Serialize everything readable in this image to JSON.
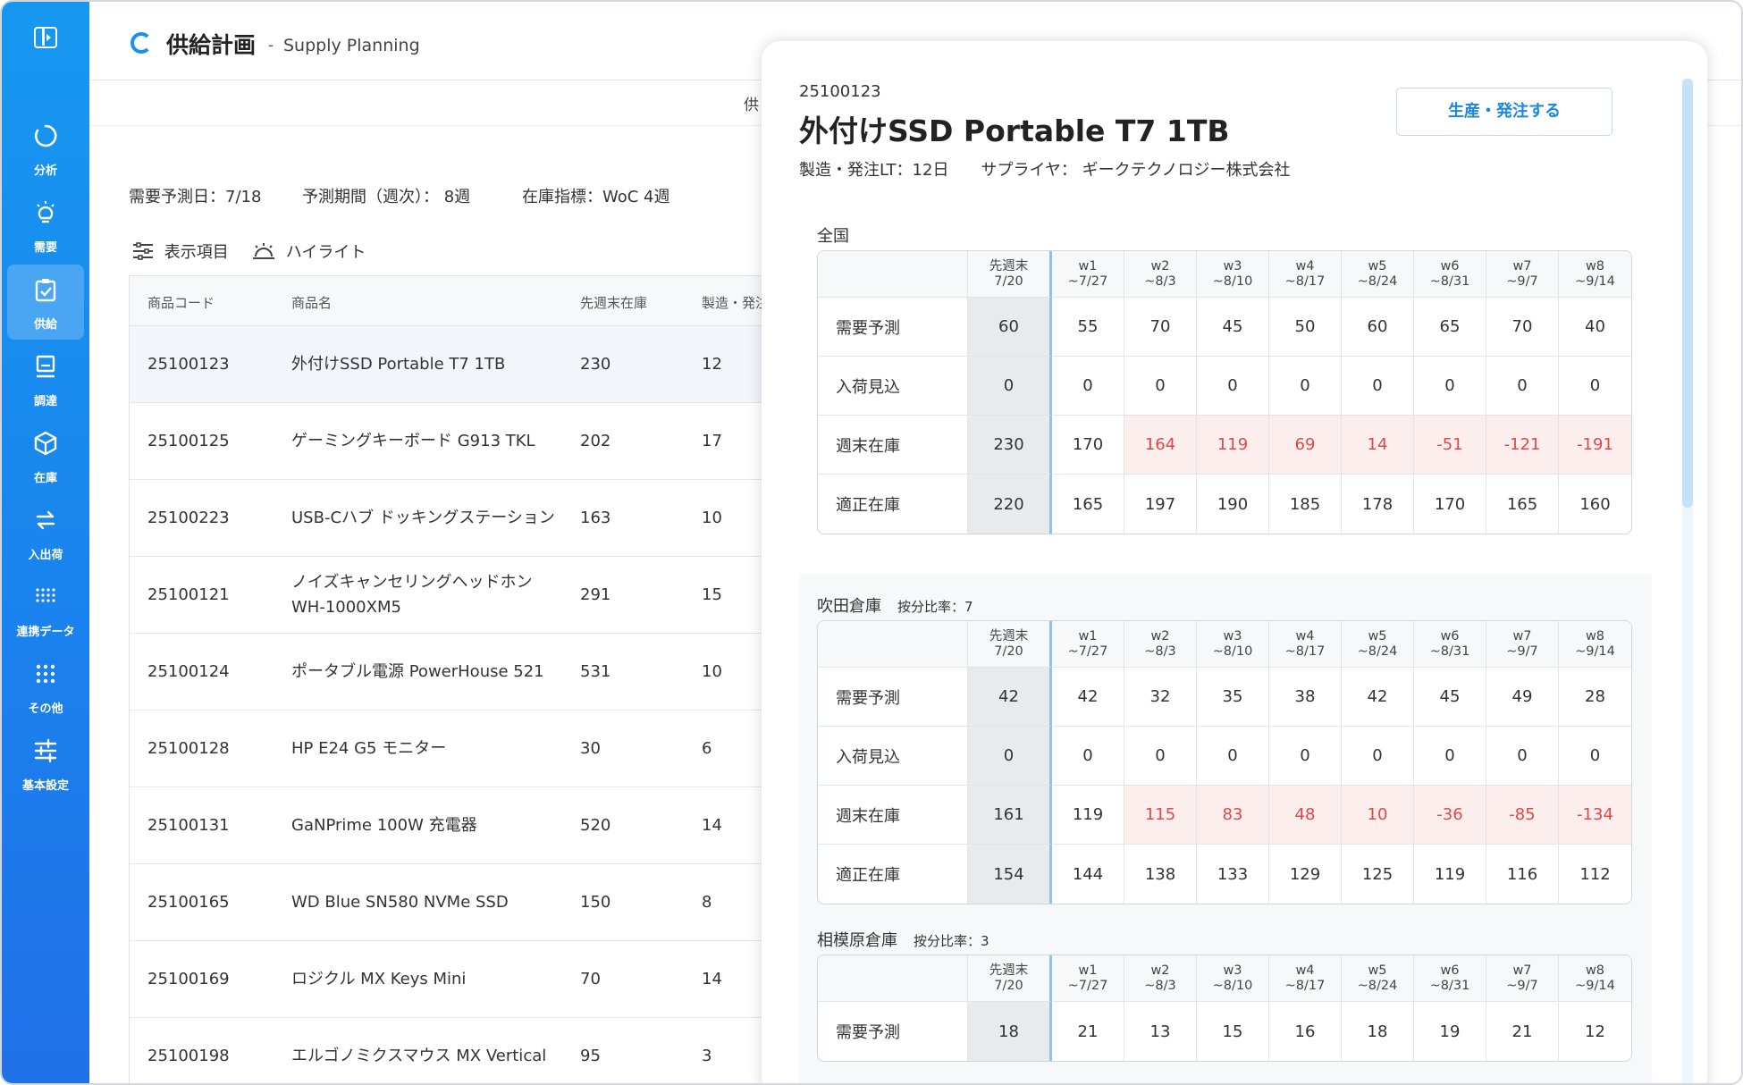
{
  "nav": [
    {
      "name": "analysis",
      "label": "分析",
      "icon": "loading-ring-icon"
    },
    {
      "name": "demand",
      "label": "需要",
      "icon": "light-bulb-icon"
    },
    {
      "name": "supply",
      "label": "供給",
      "icon": "clipboard-check-icon",
      "active": true
    },
    {
      "name": "procurement",
      "label": "調達",
      "icon": "monitor-icon"
    },
    {
      "name": "inventory",
      "label": "在庫",
      "icon": "box-icon"
    },
    {
      "name": "inout",
      "label": "入出荷",
      "icon": "swap-arrows-icon"
    },
    {
      "name": "integration",
      "label": "連携データ",
      "icon": "dots-grid-icon"
    },
    {
      "name": "other",
      "label": "その他",
      "icon": "dots-icon"
    },
    {
      "name": "settings",
      "label": "基本設定",
      "icon": "sliders-icon"
    }
  ],
  "header": {
    "title": "供給計画",
    "sep": "-",
    "subtitle": "Supply Planning"
  },
  "subbar": {
    "text": "供"
  },
  "info": {
    "forecast_date": "需要予測日：7/18",
    "period": "予測期間（週次）： 8週",
    "indicator": "在庫指標：WoC 4週"
  },
  "toolbar": {
    "display_items": "表示項目",
    "highlight": "ハイライト"
  },
  "list": {
    "headers": [
      "商品コード",
      "商品名",
      "先週末在庫",
      "製造・発注"
    ],
    "rows": [
      {
        "code": "25100123",
        "name": "外付けSSD Portable T7 1TB",
        "stock": "230",
        "lt": "12"
      },
      {
        "code": "25100125",
        "name": "ゲーミングキーボード G913 TKL",
        "stock": "202",
        "lt": "17"
      },
      {
        "code": "25100223",
        "name": "USB-Cハブ ドッキングステーション",
        "stock": "163",
        "lt": "10"
      },
      {
        "code": "25100121",
        "name": "ノイズキャンセリングヘッドホン WH-1000XM5",
        "stock": "291",
        "lt": "15"
      },
      {
        "code": "25100124",
        "name": "ポータブル電源 PowerHouse 521",
        "stock": "531",
        "lt": "10"
      },
      {
        "code": "25100128",
        "name": "HP E24 G5 モニター",
        "stock": "30",
        "lt": "6"
      },
      {
        "code": "25100131",
        "name": "GaNPrime 100W 充電器",
        "stock": "520",
        "lt": "14"
      },
      {
        "code": "25100165",
        "name": "WD Blue SN580 NVMe SSD",
        "stock": "150",
        "lt": "8"
      },
      {
        "code": "25100169",
        "name": "ロジクル MX Keys Mini",
        "stock": "70",
        "lt": "14"
      },
      {
        "code": "25100198",
        "name": "エルゴノミクスマウス MX Vertical",
        "stock": "95",
        "lt": "3"
      }
    ]
  },
  "detail": {
    "code": "25100123",
    "title": "外付けSSD Portable T7 1TB",
    "meta": "製造・発注LT：12日　　サプライヤ： ギークテクノロジー株式会社",
    "order_button": "生産・発注する",
    "columns": [
      {
        "top": "先週末",
        "bottom": "7/20"
      },
      {
        "top": "w1",
        "bottom": "~7/27"
      },
      {
        "top": "w2",
        "bottom": "~8/3"
      },
      {
        "top": "w3",
        "bottom": "~8/10"
      },
      {
        "top": "w4",
        "bottom": "~8/17"
      },
      {
        "top": "w5",
        "bottom": "~8/24"
      },
      {
        "top": "w6",
        "bottom": "~8/31"
      },
      {
        "top": "w7",
        "bottom": "~9/7"
      },
      {
        "top": "w8",
        "bottom": "~9/14"
      }
    ],
    "sections": [
      {
        "title": "全国",
        "ratio": "",
        "rows": [
          {
            "label": "需要予測",
            "values": [
              "60",
              "55",
              "70",
              "45",
              "50",
              "60",
              "65",
              "70",
              "40"
            ]
          },
          {
            "label": "入荷見込",
            "values": [
              "0",
              "0",
              "0",
              "0",
              "0",
              "0",
              "0",
              "0",
              "0"
            ]
          },
          {
            "label": "週末在庫",
            "values": [
              "230",
              "170",
              "164",
              "119",
              "69",
              "14",
              "-51",
              "-121",
              "-191"
            ],
            "highlight": [
              false,
              false,
              true,
              true,
              true,
              true,
              true,
              true,
              true
            ]
          },
          {
            "label": "適正在庫",
            "values": [
              "220",
              "165",
              "197",
              "190",
              "185",
              "178",
              "170",
              "165",
              "160"
            ]
          }
        ]
      },
      {
        "title": "吹田倉庫",
        "ratio": "按分比率：7",
        "rows": [
          {
            "label": "需要予測",
            "values": [
              "42",
              "42",
              "32",
              "35",
              "38",
              "42",
              "45",
              "49",
              "28"
            ]
          },
          {
            "label": "入荷見込",
            "values": [
              "0",
              "0",
              "0",
              "0",
              "0",
              "0",
              "0",
              "0",
              "0"
            ]
          },
          {
            "label": "週末在庫",
            "values": [
              "161",
              "119",
              "115",
              "83",
              "48",
              "10",
              "-36",
              "-85",
              "-134"
            ],
            "highlight": [
              false,
              false,
              true,
              true,
              true,
              true,
              true,
              true,
              true
            ]
          },
          {
            "label": "適正在庫",
            "values": [
              "154",
              "144",
              "138",
              "133",
              "129",
              "125",
              "119",
              "116",
              "112"
            ]
          }
        ]
      },
      {
        "title": "相模原倉庫",
        "ratio": "按分比率：3",
        "rows": [
          {
            "label": "需要予測",
            "values": [
              "18",
              "21",
              "13",
              "15",
              "16",
              "18",
              "19",
              "21",
              "12"
            ]
          }
        ]
      }
    ]
  },
  "colors": {
    "accent": "#1a8cf0",
    "negative_text": "#e04848",
    "negative_bg": "#fdeeee"
  }
}
